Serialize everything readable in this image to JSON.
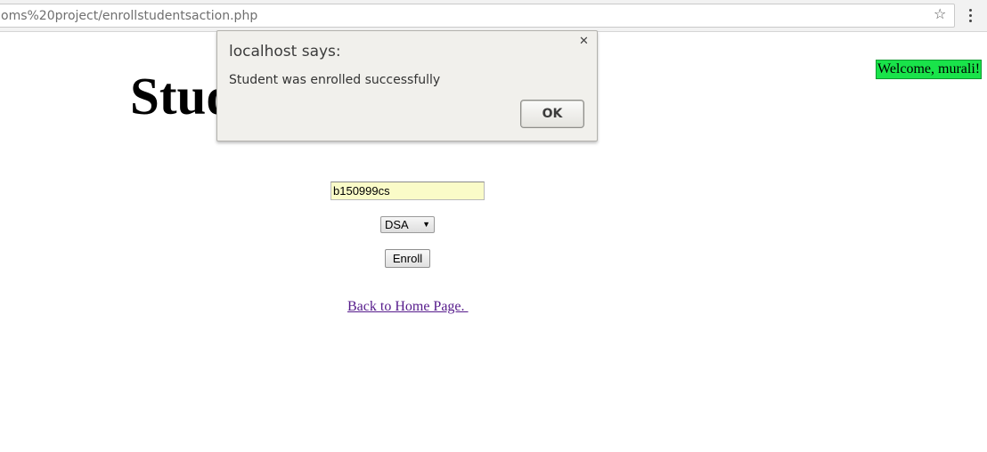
{
  "browser": {
    "url": "oms%20project/enrollstudentsaction.php",
    "star_icon": "bookmark-star-icon",
    "menu_icon": "kebab-menu-icon"
  },
  "page": {
    "title": "Student",
    "welcome": "Welcome, murali!",
    "welcome_color": "#19e34a",
    "student_id_value": "b150999cs",
    "student_id_bg": "#fafbc8",
    "course_selected": "DSA",
    "enroll_label": "Enroll",
    "home_link": "Back to Home Page. ",
    "link_color": "#551a8b"
  },
  "alert": {
    "title": "localhost says:",
    "message": "Student was enrolled successfully",
    "ok_label": "OK",
    "close_icon": "close-icon"
  }
}
